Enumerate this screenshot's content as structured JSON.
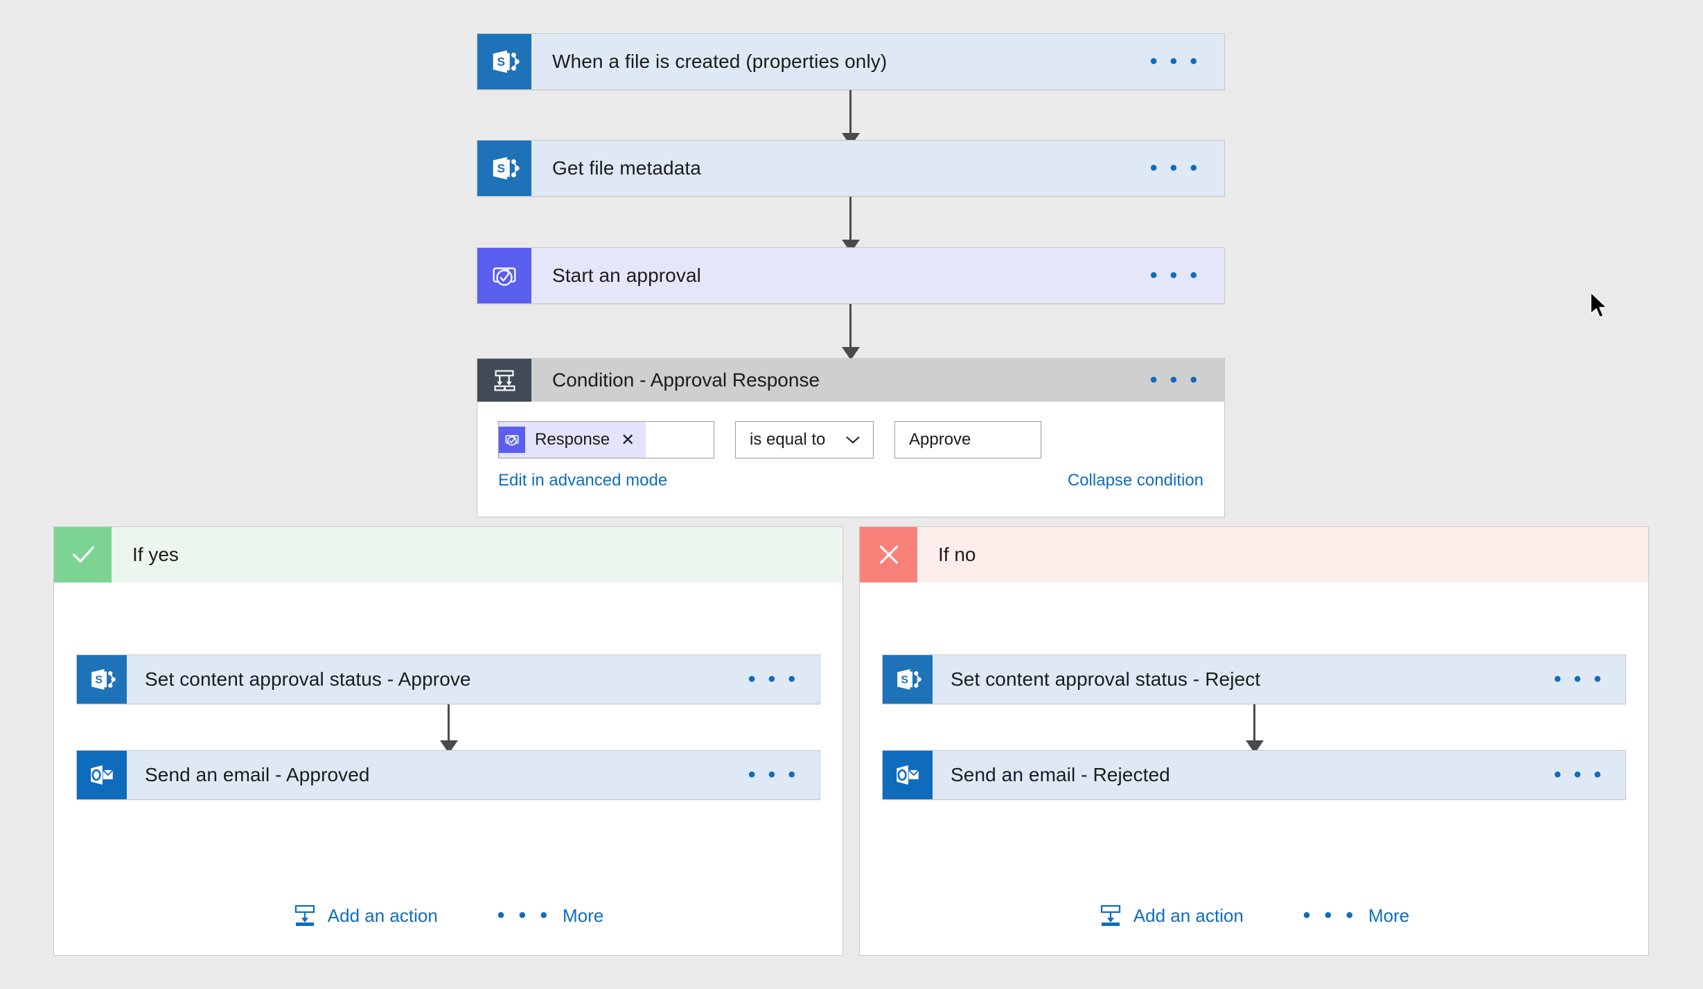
{
  "flow": {
    "trigger": {
      "title": "When a file is created (properties only)",
      "icon": "sharepoint-icon",
      "menu": "• • •"
    },
    "steps": [
      {
        "title": "Get file metadata",
        "icon": "sharepoint-icon",
        "menu": "• • •"
      },
      {
        "title": "Start an approval",
        "icon": "approval-icon",
        "menu": "• • •"
      }
    ],
    "condition": {
      "title": "Condition - Approval Response",
      "icon": "condition-icon",
      "menu": "• • •",
      "operand_token": "Response",
      "token_remove": "✕",
      "operator": "is equal to",
      "operator_chevron": "⌄",
      "value": "Approve",
      "advanced_link": "Edit in advanced mode",
      "collapse_link": "Collapse condition"
    },
    "branches": [
      {
        "key": "yes",
        "label": "If yes",
        "badge_glyph": "✓",
        "actions": [
          {
            "title": "Set content approval status - Approve",
            "icon": "sharepoint-icon",
            "menu": "• • •"
          },
          {
            "title": "Send an email - Approved",
            "icon": "outlook-icon",
            "menu": "• • •"
          }
        ],
        "add_action_label": "Add an action",
        "more_label": "More",
        "more_dots": "• • •"
      },
      {
        "key": "no",
        "label": "If no",
        "badge_glyph": "✕",
        "actions": [
          {
            "title": "Set content approval status - Reject",
            "icon": "sharepoint-icon",
            "menu": "• • •"
          },
          {
            "title": "Send an email - Rejected",
            "icon": "outlook-icon",
            "menu": "• • •"
          }
        ],
        "add_action_label": "Add an action",
        "more_label": "More",
        "more_dots": "• • •"
      }
    ]
  },
  "colors": {
    "canvas": "#eaeaea",
    "card_blue": "#dfe9f5",
    "card_lavender": "#e6e6fb",
    "condition_gray": "#cfcfcf",
    "sharepoint": "#1d72b8",
    "approval": "#5b5fef",
    "condition_icon": "#414b55",
    "outlook": "#0f6cbd",
    "yes_badge": "#7cd492",
    "yes_band": "#ecf6ee",
    "no_badge": "#f8827a",
    "no_band": "#fdeeec",
    "link": "#0f6cbd",
    "connector": "#4a4a4a"
  }
}
